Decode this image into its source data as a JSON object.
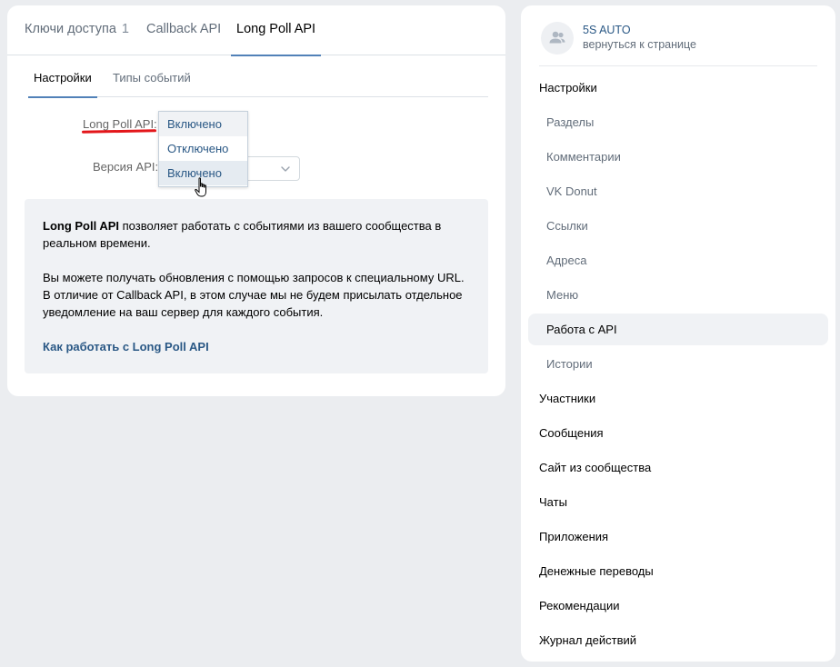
{
  "tabs": [
    {
      "label": "Ключи доступа",
      "count": "1"
    },
    {
      "label": "Callback API"
    },
    {
      "label": "Long Poll API"
    }
  ],
  "subtabs": [
    "Настройки",
    "Типы событий"
  ],
  "form": {
    "longpoll_label": "Long Poll API:",
    "version_label": "Версия API:"
  },
  "dropdown": {
    "options": [
      "Включено",
      "Отключено",
      "Включено"
    ]
  },
  "info": {
    "p1_bold": "Long Poll API",
    "p1_line1": " позволяет работать с событиями из вашего сообщества в",
    "p1_line2": "реальном времени.",
    "p2_line1": "Вы можете получать обновления с помощью запросов к специальному URL.",
    "p2_line2": "В отличие от Callback API, в этом случае мы не будем присылать отдельное",
    "p2_line3": "уведомление на ваш сервер для каждого события.",
    "link": "Как работать с Long Poll API"
  },
  "group": {
    "name": "5S AUTO",
    "back": "вернуться к странице"
  },
  "menu": [
    {
      "label": "Настройки",
      "level": "top"
    },
    {
      "label": "Разделы",
      "level": "sub"
    },
    {
      "label": "Комментарии",
      "level": "sub"
    },
    {
      "label": "VK Donut",
      "level": "sub"
    },
    {
      "label": "Ссылки",
      "level": "sub"
    },
    {
      "label": "Адреса",
      "level": "sub"
    },
    {
      "label": "Меню",
      "level": "sub"
    },
    {
      "label": "Работа с API",
      "level": "sub",
      "active": true
    },
    {
      "label": "Истории",
      "level": "sub"
    },
    {
      "label": "Участники",
      "level": "top"
    },
    {
      "label": "Сообщения",
      "level": "top"
    },
    {
      "label": "Сайт из сообщества",
      "level": "top"
    },
    {
      "label": "Чаты",
      "level": "top"
    },
    {
      "label": "Приложения",
      "level": "top"
    },
    {
      "label": "Денежные переводы",
      "level": "top"
    },
    {
      "label": "Рекомендации",
      "level": "top"
    },
    {
      "label": "Журнал действий",
      "level": "top"
    }
  ],
  "colors": {
    "accent": "#5181b8",
    "link": "#2a5885",
    "annotation_underline": "#e3161a"
  }
}
